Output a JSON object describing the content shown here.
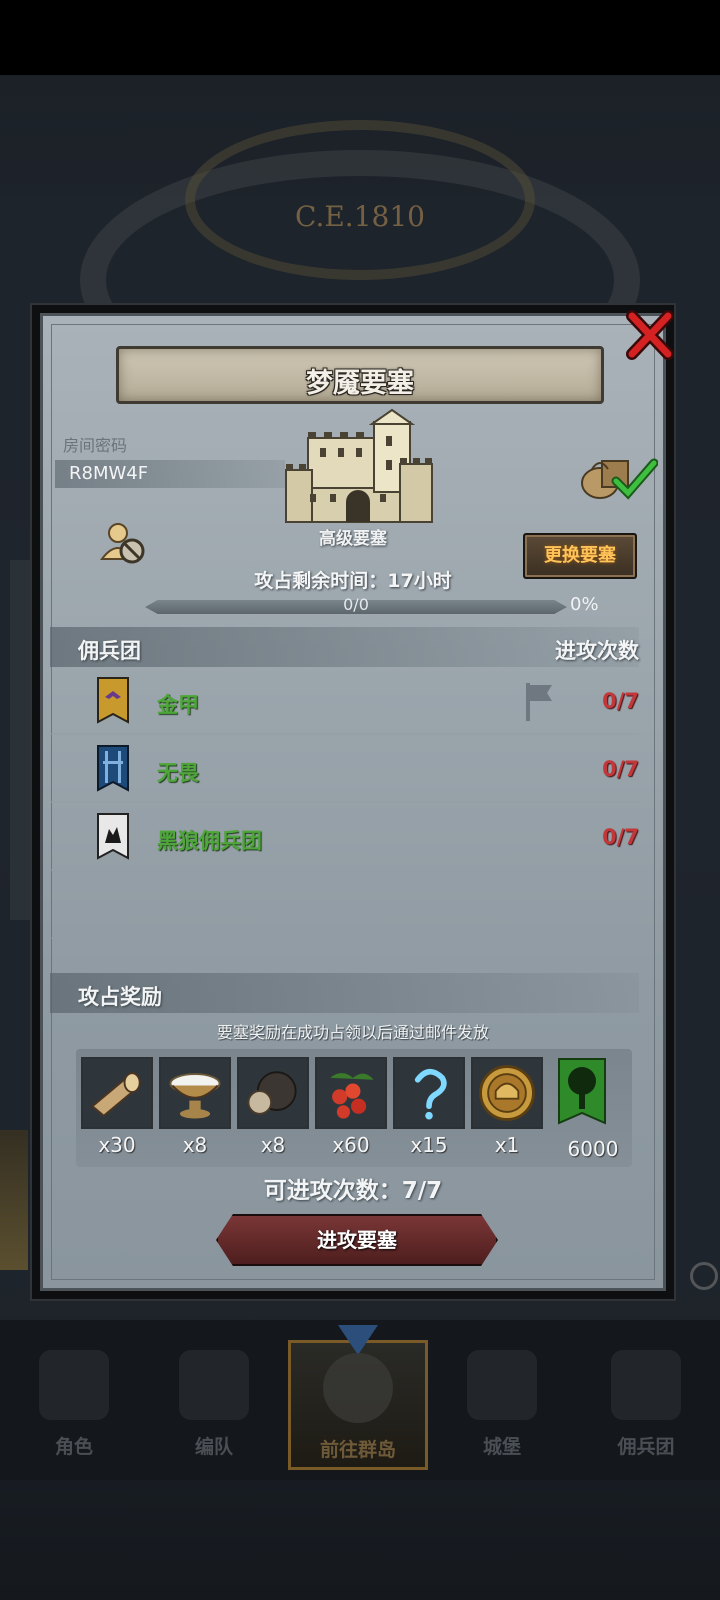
{
  "background": {
    "year": "C.E.1810"
  },
  "dialog": {
    "title": "梦魇要塞",
    "room_label": "房间密码",
    "room_code": "R8MW4F",
    "fortress_level": "高级要塞",
    "change_button": "更换要塞",
    "remaining_time": "攻占剩余时间：17小时",
    "progress": {
      "text": "0/0",
      "percent_text": "0%",
      "fraction": 0
    },
    "mercenary_section": {
      "title": "佣兵团",
      "attacks_header": "进攻次数"
    },
    "mercenaries": [
      {
        "name": "金甲",
        "attacks": "0/7",
        "banner_color": "#c89a2e"
      },
      {
        "name": "无畏",
        "attacks": "0/7",
        "banner_color": "#1e4a7a"
      },
      {
        "name": "黑狼佣兵团",
        "attacks": "0/7",
        "banner_color": "#e8e8e8"
      }
    ],
    "reward_section": {
      "title": "攻占奖励",
      "note": "要塞奖励在成功占领以后通过邮件发放"
    },
    "rewards": [
      {
        "icon": "wood-log-icon",
        "qty": "x30"
      },
      {
        "icon": "cream-bowl-icon",
        "qty": "x8"
      },
      {
        "icon": "truffle-icon",
        "qty": "x8"
      },
      {
        "icon": "berries-icon",
        "qty": "x60"
      },
      {
        "icon": "question-rune-icon",
        "qty": "x15"
      },
      {
        "icon": "helmet-medal-icon",
        "qty": "x1"
      },
      {
        "icon": "tree-banner-icon",
        "qty": "6000"
      }
    ],
    "available_attacks": "可进攻次数：7/7",
    "attack_button": "进攻要塞"
  },
  "bottom_nav": [
    {
      "label": "角色",
      "active": false
    },
    {
      "label": "编队",
      "active": false
    },
    {
      "label": "前往群岛",
      "active": true
    },
    {
      "label": "城堡",
      "active": false
    },
    {
      "label": "佣兵团",
      "active": false
    }
  ],
  "colors": {
    "mercenary_name": "#4ea63a",
    "attack_count": "#c2373a",
    "change_button_text": "#ffc35a",
    "attack_button": "#7a3636"
  }
}
